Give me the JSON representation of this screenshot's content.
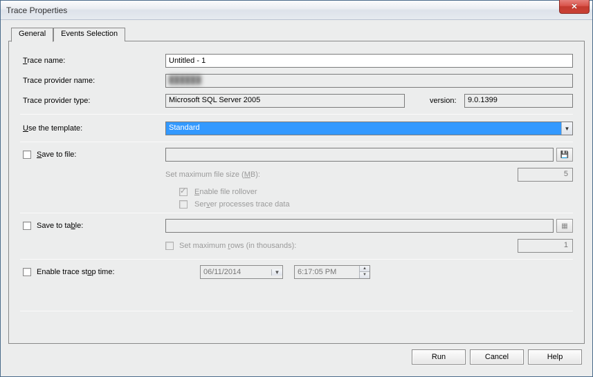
{
  "window": {
    "title": "Trace Properties"
  },
  "tabs": {
    "general": "General",
    "events": "Events Selection"
  },
  "labels": {
    "trace_name": "Trace name:",
    "provider_name": "Trace provider name:",
    "provider_type": "Trace provider type:",
    "version": "version:",
    "use_template": "Use the template:",
    "save_file": "Save to file:",
    "max_file": "Set maximum file size (MB):",
    "rollover": "Enable file rollover",
    "server_proc": "Server processes trace data",
    "save_table": "Save to table:",
    "max_rows": "Set maximum rows (in thousands):",
    "stop_time": "Enable trace stop time:"
  },
  "values": {
    "trace_name": "Untitled - 1",
    "provider_name": "██████",
    "provider_type": "Microsoft SQL Server 2005",
    "version": "9.0.1399",
    "template": "Standard",
    "max_file": "5",
    "max_rows": "1",
    "stop_date": "06/11/2014",
    "stop_time": "6:17:05 PM"
  },
  "buttons": {
    "run": "Run",
    "cancel": "Cancel",
    "help": "Help"
  }
}
